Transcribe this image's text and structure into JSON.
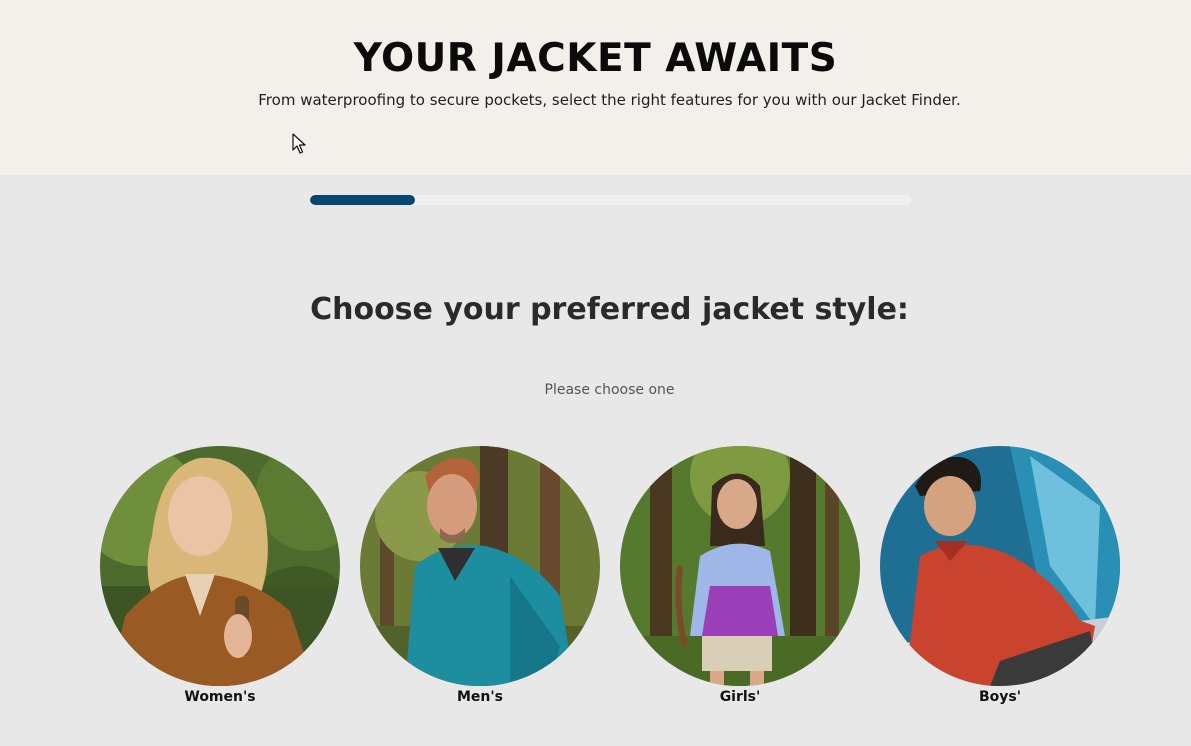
{
  "hero": {
    "title": "YOUR JACKET AWAITS",
    "subtitle": "From waterproofing to secure pockets, select the right features for you with our Jacket Finder."
  },
  "progress": {
    "fraction": 0.175,
    "fill_color": "#07466f"
  },
  "quiz": {
    "question": "Choose your preferred jacket style:",
    "hint": "Please choose one",
    "options": [
      {
        "label": "Women's",
        "image": "woman-brown-jacket-photo"
      },
      {
        "label": "Men's",
        "image": "man-teal-rain-jacket-photo"
      },
      {
        "label": "Girls'",
        "image": "girl-purple-windbreaker-photo"
      },
      {
        "label": "Boys'",
        "image": "boy-red-fleece-tent-photo"
      }
    ]
  }
}
